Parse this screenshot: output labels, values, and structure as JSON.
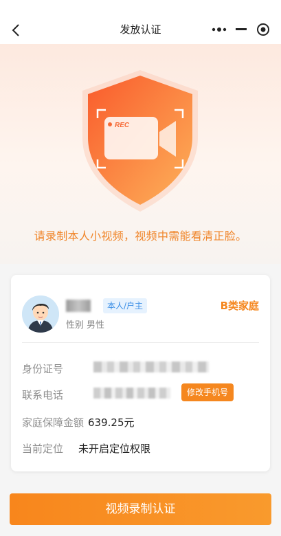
{
  "nav": {
    "title": "发放认证"
  },
  "hero": {
    "rec_text": "REC",
    "hint": "请录制本人小视频，视频中需能看清正脸。"
  },
  "person": {
    "role_tag": "本人/户主",
    "family_type": "B类家庭",
    "gender_label": "性别",
    "gender_value": "男性"
  },
  "fields": {
    "id_label": "身份证号",
    "phone_label": "联系电话",
    "phone_edit": "修改手机号",
    "amount_label": "家庭保障金额",
    "amount_value": "639.25元",
    "location_label": "当前定位",
    "location_value": "未开启定位权限"
  },
  "actions": {
    "record_button": "视频录制认证"
  },
  "colors": {
    "accent": "#f5871f",
    "tag_bg": "#e6f2fe",
    "tag_text": "#3a8ee6"
  }
}
